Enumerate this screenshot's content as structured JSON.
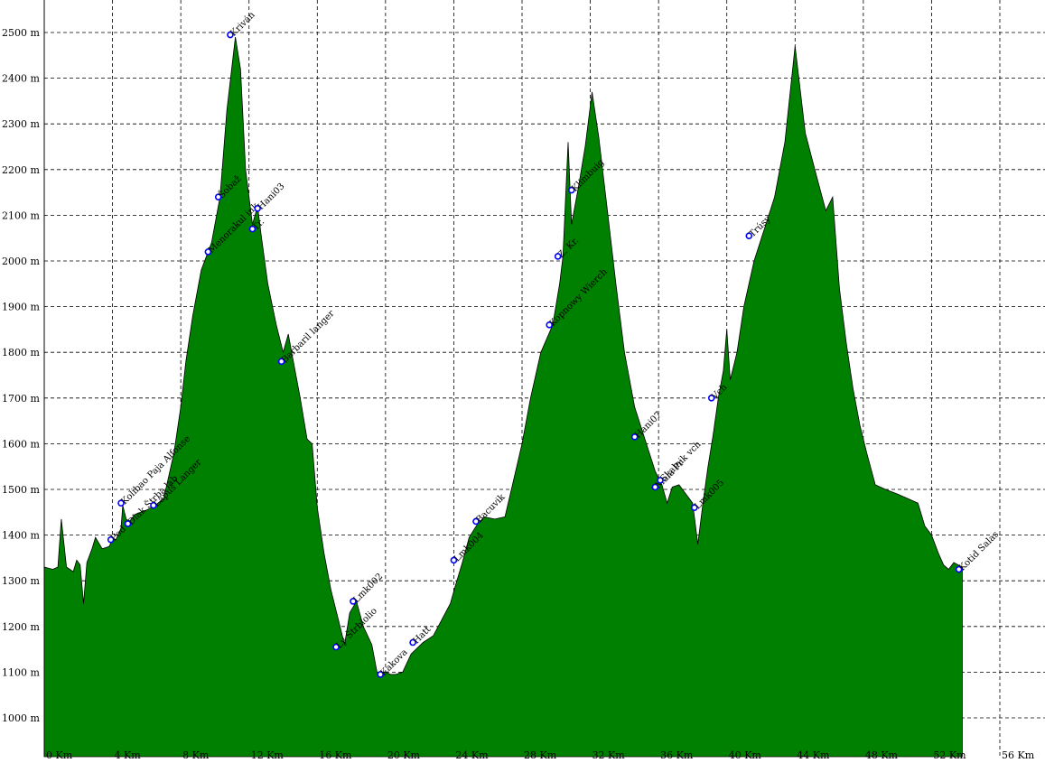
{
  "chart_data": {
    "type": "area",
    "fill_color": "#008000",
    "outline_color": "#000000",
    "marker_color": "#0000ff",
    "grid": true,
    "xlim": [
      0,
      56
    ],
    "ylim": [
      950,
      2530
    ],
    "x_ticks": [
      0,
      4,
      8,
      12,
      16,
      20,
      24,
      28,
      32,
      36,
      40,
      44,
      48,
      52,
      56
    ],
    "x_tick_labels": [
      "0 Km",
      "4 Km",
      "8 Km",
      "12 Km",
      "16 Km",
      "20 Km",
      "24 Km",
      "28 Km",
      "32 Km",
      "36 Km",
      "40 Km",
      "44 Km",
      "48 Km",
      "52 Km",
      "56 Km"
    ],
    "y_ticks": [
      1000,
      1100,
      1200,
      1300,
      1400,
      1500,
      1600,
      1700,
      1800,
      1900,
      2000,
      2100,
      2200,
      2300,
      2400,
      2500
    ],
    "y_tick_labels": [
      "1000 m",
      "1100 m",
      "1200 m",
      "1300 m",
      "1400 m",
      "1500 m",
      "1600 m",
      "1700 m",
      "1800 m",
      "1900 m",
      "2000 m",
      "2100 m",
      "2200 m",
      "2300 m",
      "2400 m",
      "2500 m"
    ],
    "profile": [
      [
        0,
        1330
      ],
      [
        0.5,
        1325
      ],
      [
        0.8,
        1330
      ],
      [
        1.0,
        1435
      ],
      [
        1.3,
        1330
      ],
      [
        1.7,
        1320
      ],
      [
        1.9,
        1345
      ],
      [
        2.1,
        1335
      ],
      [
        2.3,
        1250
      ],
      [
        2.5,
        1340
      ],
      [
        2.8,
        1370
      ],
      [
        3.0,
        1395
      ],
      [
        3.4,
        1370
      ],
      [
        3.8,
        1375
      ],
      [
        4.0,
        1390
      ],
      [
        4.2,
        1390
      ],
      [
        4.5,
        1415
      ],
      [
        4.6,
        1465
      ],
      [
        4.8,
        1435
      ],
      [
        5.0,
        1430
      ],
      [
        5.3,
        1445
      ],
      [
        6.0,
        1455
      ],
      [
        6.5,
        1465
      ],
      [
        7.0,
        1480
      ],
      [
        7.6,
        1580
      ],
      [
        8.0,
        1680
      ],
      [
        8.3,
        1780
      ],
      [
        8.7,
        1880
      ],
      [
        9.2,
        1980
      ],
      [
        9.8,
        2040
      ],
      [
        10.3,
        2140
      ],
      [
        10.7,
        2330
      ],
      [
        11.2,
        2490
      ],
      [
        11.5,
        2420
      ],
      [
        11.8,
        2200
      ],
      [
        12.2,
        2080
      ],
      [
        12.5,
        2120
      ],
      [
        12.7,
        2060
      ],
      [
        13.1,
        1950
      ],
      [
        13.6,
        1860
      ],
      [
        14.0,
        1800
      ],
      [
        14.3,
        1840
      ],
      [
        14.6,
        1780
      ],
      [
        15.0,
        1700
      ],
      [
        15.4,
        1610
      ],
      [
        15.7,
        1600
      ],
      [
        16.0,
        1460
      ],
      [
        16.4,
        1360
      ],
      [
        16.8,
        1280
      ],
      [
        17.2,
        1220
      ],
      [
        17.6,
        1160
      ],
      [
        17.9,
        1230
      ],
      [
        18.3,
        1255
      ],
      [
        18.7,
        1200
      ],
      [
        19.2,
        1160
      ],
      [
        19.5,
        1100
      ],
      [
        20.0,
        1100
      ],
      [
        20.3,
        1095
      ],
      [
        20.6,
        1095
      ],
      [
        21.0,
        1100
      ],
      [
        21.5,
        1140
      ],
      [
        22.2,
        1165
      ],
      [
        22.8,
        1180
      ],
      [
        23.3,
        1215
      ],
      [
        23.8,
        1250
      ],
      [
        24.1,
        1290
      ],
      [
        24.5,
        1340
      ],
      [
        24.9,
        1395
      ],
      [
        25.4,
        1425
      ],
      [
        25.8,
        1440
      ],
      [
        26.4,
        1435
      ],
      [
        27.0,
        1440
      ],
      [
        27.5,
        1520
      ],
      [
        28.0,
        1600
      ],
      [
        28.5,
        1700
      ],
      [
        29.1,
        1800
      ],
      [
        29.8,
        1860
      ],
      [
        30.2,
        1950
      ],
      [
        30.4,
        2010
      ],
      [
        30.7,
        2260
      ],
      [
        30.9,
        2080
      ],
      [
        31.3,
        2160
      ],
      [
        31.7,
        2250
      ],
      [
        32.1,
        2370
      ],
      [
        32.5,
        2270
      ],
      [
        33.0,
        2110
      ],
      [
        33.5,
        1950
      ],
      [
        34.0,
        1800
      ],
      [
        34.6,
        1680
      ],
      [
        35.2,
        1610
      ],
      [
        35.8,
        1540
      ],
      [
        36.2,
        1510
      ],
      [
        36.5,
        1470
      ],
      [
        36.8,
        1505
      ],
      [
        37.2,
        1510
      ],
      [
        37.6,
        1490
      ],
      [
        38.0,
        1470
      ],
      [
        38.3,
        1380
      ],
      [
        38.6,
        1470
      ],
      [
        38.9,
        1550
      ],
      [
        39.2,
        1620
      ],
      [
        39.5,
        1700
      ],
      [
        39.8,
        1760
      ],
      [
        40.0,
        1850
      ],
      [
        40.2,
        1740
      ],
      [
        40.6,
        1800
      ],
      [
        41.0,
        1900
      ],
      [
        41.6,
        2000
      ],
      [
        42.2,
        2070
      ],
      [
        42.8,
        2140
      ],
      [
        43.4,
        2260
      ],
      [
        44.0,
        2470
      ],
      [
        44.6,
        2280
      ],
      [
        45.3,
        2180
      ],
      [
        45.8,
        2110
      ],
      [
        46.2,
        2140
      ],
      [
        46.6,
        1940
      ],
      [
        47.0,
        1820
      ],
      [
        47.4,
        1720
      ],
      [
        47.8,
        1640
      ],
      [
        48.2,
        1580
      ],
      [
        48.7,
        1510
      ],
      [
        49.3,
        1500
      ],
      [
        50.0,
        1490
      ],
      [
        50.6,
        1480
      ],
      [
        51.2,
        1470
      ],
      [
        51.6,
        1420
      ],
      [
        52.0,
        1400
      ],
      [
        52.4,
        1360
      ],
      [
        52.7,
        1335
      ],
      [
        53.0,
        1325
      ],
      [
        53.3,
        1340
      ],
      [
        53.8,
        1330
      ]
    ],
    "waypoints": [
      {
        "x": 3.9,
        "y": 1390,
        "label": "Pod"
      },
      {
        "x": 4.5,
        "y": 1470,
        "label": "Kolibao Paja Alfonse"
      },
      {
        "x": 4.9,
        "y": 1425,
        "label": "Dlak Štrba lab"
      },
      {
        "x": 6.4,
        "y": 1465,
        "label": "Lapuš Langer"
      },
      {
        "x": 9.6,
        "y": 2020,
        "label": "Menorakul ink"
      },
      {
        "x": 10.2,
        "y": 2140,
        "label": "Šobaž"
      },
      {
        "x": 10.9,
        "y": 2495,
        "label": "Kriván"
      },
      {
        "x": 12.2,
        "y": 2070,
        "label": "Tr."
      },
      {
        "x": 12.5,
        "y": 2115,
        "label": "Hani03"
      },
      {
        "x": 13.9,
        "y": 1780,
        "label": "Barbaril langer"
      },
      {
        "x": 17.1,
        "y": 1155,
        "label": "Ly Štrbiolio"
      },
      {
        "x": 18.1,
        "y": 1255,
        "label": "Lmk002"
      },
      {
        "x": 19.7,
        "y": 1095,
        "label": "Kakova"
      },
      {
        "x": 21.6,
        "y": 1165,
        "label": "Hatt"
      },
      {
        "x": 24.0,
        "y": 1345,
        "label": "Lmk004"
      },
      {
        "x": 25.3,
        "y": 1430,
        "label": "Bacuvik"
      },
      {
        "x": 29.6,
        "y": 1860,
        "label": "Kopnowy Wierch"
      },
      {
        "x": 30.1,
        "y": 2010,
        "label": "Z. Kr."
      },
      {
        "x": 30.9,
        "y": 2155,
        "label": "Klimbuig"
      },
      {
        "x": 34.6,
        "y": 1615,
        "label": "Hani07"
      },
      {
        "x": 35.8,
        "y": 1505,
        "label": "Mala Pr"
      },
      {
        "x": 36.1,
        "y": 1520,
        "label": "Skalnik vch"
      },
      {
        "x": 38.1,
        "y": 1460,
        "label": "Lmk005"
      },
      {
        "x": 39.1,
        "y": 1700,
        "label": "Vch"
      },
      {
        "x": 41.3,
        "y": 2055,
        "label": "Trúsy"
      },
      {
        "x": 53.6,
        "y": 1325,
        "label": "Kotid Salas"
      }
    ]
  }
}
